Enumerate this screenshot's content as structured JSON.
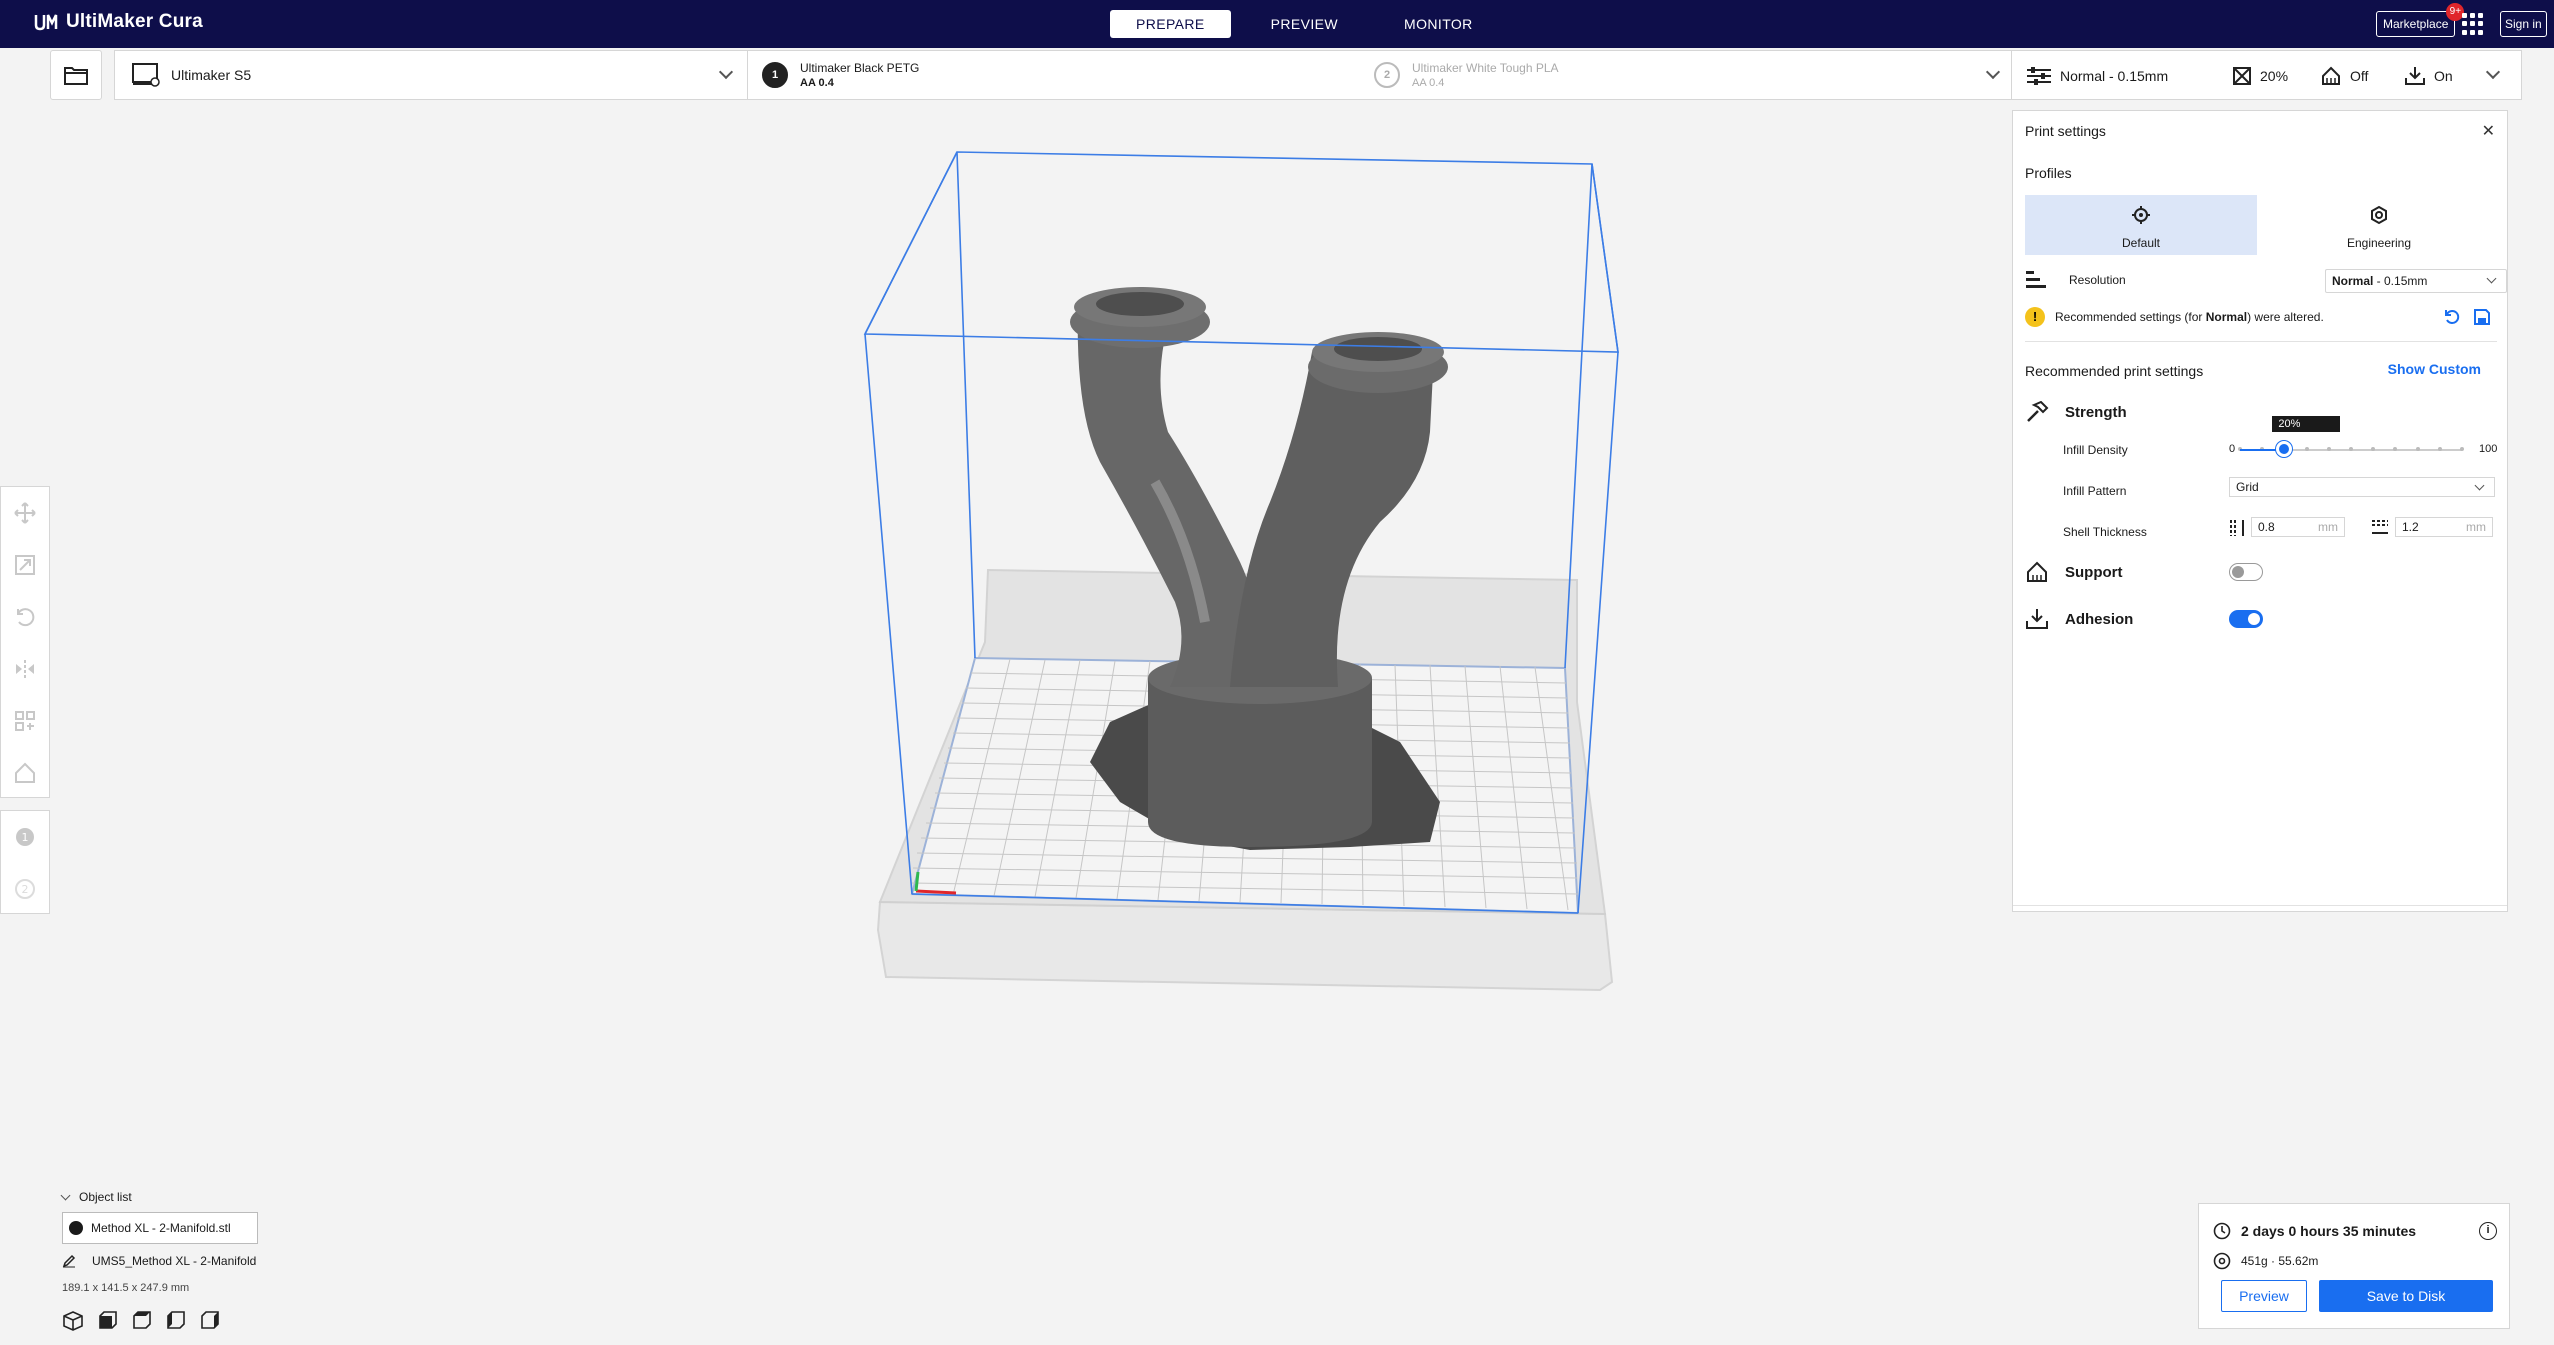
{
  "app": {
    "title": "UltiMaker Cura"
  },
  "stages": [
    {
      "label": "PREPARE",
      "active": true
    },
    {
      "label": "PREVIEW",
      "active": false
    },
    {
      "label": "MONITOR",
      "active": false
    }
  ],
  "topbar": {
    "marketplace_label": "Marketplace",
    "marketplace_badge": "9+",
    "signin_label": "Sign in"
  },
  "machine": {
    "name": "Ultimaker S5"
  },
  "extruders": [
    {
      "number": "1",
      "material": "Ultimaker Black PETG",
      "core": "AA 0.4",
      "enabled": true
    },
    {
      "number": "2",
      "material": "Ultimaker White Tough PLA",
      "core": "AA 0.4",
      "enabled": false
    }
  ],
  "settings_summary": {
    "profile": "Normal - 0.15mm",
    "infill": "20%",
    "support": "Off",
    "adhesion": "On"
  },
  "print_settings": {
    "title": "Print settings",
    "profiles_label": "Profiles",
    "profiles": [
      {
        "label": "Default",
        "active": true
      },
      {
        "label": "Engineering",
        "active": false
      }
    ],
    "resolution_label": "Resolution",
    "resolution_value_bold": "Normal",
    "resolution_value_rest": " - 0.15mm",
    "warning_prefix": "Recommended settings (for ",
    "warning_bold": "Normal",
    "warning_suffix": ") were altered.",
    "recommended_title": "Recommended print settings",
    "show_custom_label": "Show Custom",
    "strength_label": "Strength",
    "infill_density_label": "Infill Density",
    "infill_min": "0",
    "infill_max": "100",
    "infill_value_label": "20%",
    "infill_fraction": 0.2,
    "infill_pattern_label": "Infill Pattern",
    "infill_pattern_value": "Grid",
    "shell_thickness_label": "Shell Thickness",
    "wall_thickness": "0.8",
    "top_bottom_thickness": "1.2",
    "unit_mm": "mm",
    "support_label": "Support",
    "support_enabled": false,
    "adhesion_label": "Adhesion",
    "adhesion_enabled": true
  },
  "object_list": {
    "header": "Object list",
    "items": [
      "Method XL - 2-Manifold.stl"
    ],
    "job_name": "UMS5_Method XL - 2-Manifold",
    "dimensions": "189.1 x 141.5 x 247.9 mm"
  },
  "action_panel": {
    "print_time": "2 days 0 hours 35 minutes",
    "material_estimate": "451g · 55.62m",
    "preview_label": "Preview",
    "save_label": "Save to Disk"
  },
  "colors": {
    "topbar": "#0e0e4a",
    "accent": "#196ef0",
    "model": "#5a5a5a",
    "warning": "#f4c21b"
  }
}
